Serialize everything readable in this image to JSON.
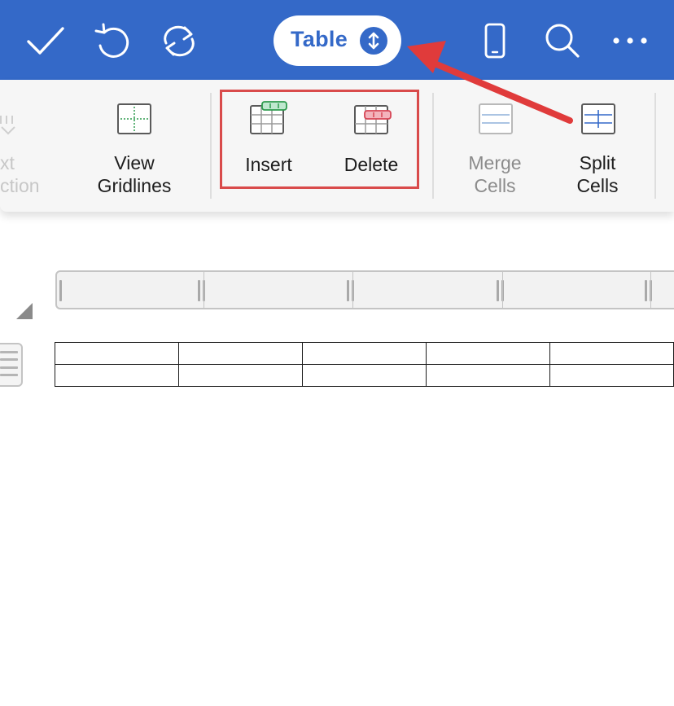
{
  "toolbar": {
    "icons": [
      "checkmark-icon",
      "undo-icon",
      "redo-icon",
      "phone-view-icon",
      "search-icon",
      "more-icon"
    ],
    "mode_selector": {
      "label": "Table",
      "icon": "chevron-up-down-icon"
    },
    "accent_color": "#3469c8"
  },
  "ribbon": {
    "items": [
      {
        "label_line1": "xt",
        "label_line2": "ction",
        "icon": "text-direction-icon",
        "enabled": false
      },
      {
        "label_line1": "View",
        "label_line2": "Gridlines",
        "icon": "view-gridlines-icon",
        "enabled": true
      },
      {
        "label_line1": "Insert",
        "icon": "insert-table-icon",
        "enabled": true
      },
      {
        "label_line1": "Delete",
        "icon": "delete-table-icon",
        "enabled": true
      },
      {
        "label_line1": "Merge",
        "label_line2": "Cells",
        "icon": "merge-cells-icon",
        "enabled": false
      },
      {
        "label_line1": "Split",
        "label_line2": "Cells",
        "icon": "split-cells-icon",
        "enabled": true
      }
    ]
  },
  "annotation": {
    "highlight_color": "#d94b4b",
    "arrow_color": "#e03b3b"
  },
  "document": {
    "table": {
      "rows": 2,
      "cells": [
        [
          "",
          "",
          "",
          "",
          ""
        ],
        [
          "",
          "",
          "",
          "",
          ""
        ]
      ]
    }
  }
}
